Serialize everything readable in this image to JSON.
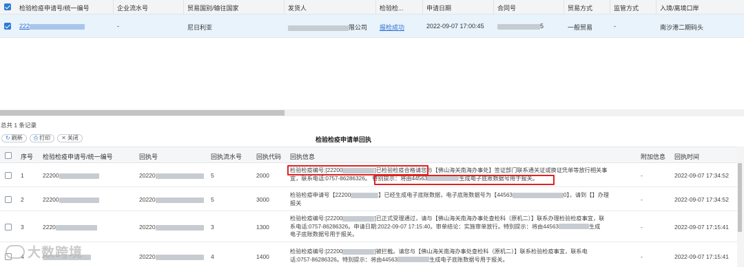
{
  "top_table": {
    "headers": [
      "检验检疫申请号/统一编号",
      "企业流水号",
      "贸易国别/输往国家",
      "发货人",
      "检验检...",
      "申请日期",
      "合同号",
      "贸易方式",
      "监管方式",
      "入境/离境口岸"
    ],
    "row": {
      "apply_no": "222",
      "enterprise_serial": "-",
      "country": "尼日利亚",
      "consignor_suffix": "限公司",
      "inspection_status": "报检成功",
      "apply_date": "2022-09-07 17:00:45",
      "contract_suffix": "5",
      "trade_mode": "一般贸易",
      "supervise_mode": "-",
      "port": "南沙港二期码头"
    }
  },
  "total_records": "总共 1 条记录",
  "toolbar": {
    "refresh_label": "刷新",
    "print_label": "打印",
    "close_label": "关闭"
  },
  "section_title": "检验检疫申请单回执",
  "bottom_table": {
    "headers": {
      "seq": "序号",
      "apply_no": "检验检疫申请号/统一编号",
      "receipt_no": "回执号",
      "receipt_serial": "回执流水号",
      "receipt_code": "回执代码",
      "receipt_info": "回执信息",
      "extra_info": "附加信息",
      "receipt_time": "回执时间"
    },
    "rows": [
      {
        "seq": "1",
        "apply_no": "22200",
        "receipt_no": "20220",
        "receipt_serial": "5",
        "receipt_code": "2000",
        "info_line1": "检验检疫编号:[22200",
        "info_line1b": "]已检验检疫合格",
        "info_line1c": "请您与【佛山海关南海办事处】签证部门联系通关证或换证凭单等放行相关事",
        "info_line2": "宜，联系电话:0757-86286326。",
        "info_line2b": "特别提示：将由44563",
        "info_line2c": "生成电子底账数据号用于报关。",
        "extra": "-",
        "time": "2022-09-07 17:34:52"
      },
      {
        "seq": "2",
        "apply_no": "22200",
        "receipt_no": "20220",
        "receipt_serial": "5",
        "receipt_code": "3000",
        "info_line1": "检验检疫申请号【22200",
        "info_line1b": "】已经生成电子底账数据，电子底账数据号为【44563",
        "info_line1c": "0】，请到【】办理",
        "info_line2": "报关",
        "extra": "-",
        "time": "2022-09-07 17:34:52"
      },
      {
        "seq": "3",
        "apply_no": "2220",
        "receipt_no": "20220",
        "receipt_serial": "3",
        "receipt_code": "1300",
        "info_line1": "检验检疫编号:[22200",
        "info_line1b": "]已正式受理通过，请与【佛山海关南海办事处查检科（原机二）】联系办理检验检疫事宜，联",
        "info_line2": "系电话:0757-86286326。申请日期:2022-09-07 17:15:40。审单结论：实施审单放行。特别提示：将由44563",
        "info_line2b": "生成",
        "info_line3": "电子底账数据号用于报关。",
        "extra": "-",
        "time": "2022-09-07 17:15:41"
      },
      {
        "seq": "4",
        "apply_no": "",
        "receipt_no": "20220",
        "receipt_serial": "4",
        "receipt_code": "1400",
        "info_line1": "检验检疫编号:[22200",
        "info_line1b": "]被拦截。请您与【佛山海关南海办事处查检科（原机二）】联系检验检疫事宜，联系电",
        "info_line2": "话:0757-86286326。特别提示：将由44563",
        "info_line2b": "生成电子底账数据号用于报关。",
        "extra": "-",
        "time": "2022-09-07 17:15:41"
      }
    ]
  },
  "watermark": "大数跨境",
  "colors": {
    "accent": "#2f7ad6",
    "link": "#2f6fd1",
    "selected_row": "#e8f3fc",
    "highlight_box": "#e02020"
  }
}
